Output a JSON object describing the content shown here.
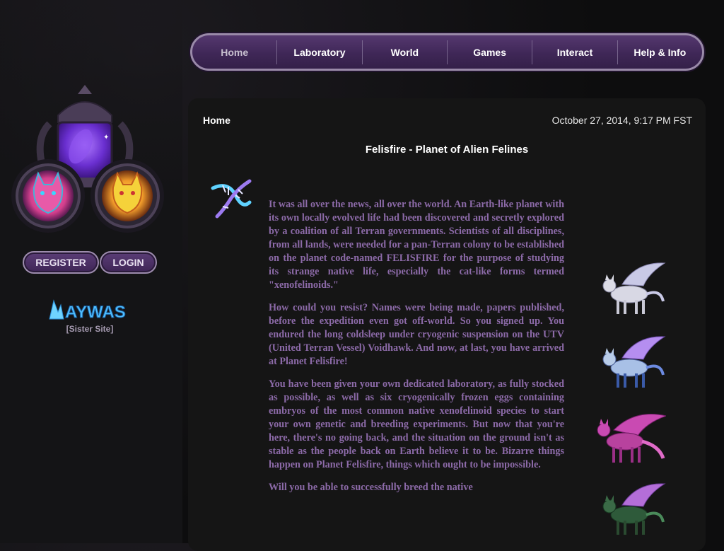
{
  "nav": {
    "items": [
      {
        "label": "Home",
        "active": true
      },
      {
        "label": "Laboratory"
      },
      {
        "label": "World"
      },
      {
        "label": "Games"
      },
      {
        "label": "Interact"
      },
      {
        "label": "Help & Info"
      }
    ]
  },
  "sidebar": {
    "register_label": "REGISTER",
    "login_label": "LOGIN",
    "sister_logo_text": "AYWAS",
    "sister_caption": "[Sister Site]"
  },
  "content": {
    "breadcrumb": "Home",
    "datetime": "October 27, 2014, 9:17 PM FST",
    "title": "Felisfire - Planet of Alien Felines",
    "paragraphs": [
      "It was all over the news, all over the world. An Earth-like planet with its own locally evolved life had been discovered and secretly explored by a coalition of all Terran governments. Scientists of all disciplines, from all lands, were needed for a pan-Terran colony to be established on the planet code-named FELISFIRE for the purpose of studying its strange native life, especially the cat-like forms termed \"xenofelinoids.\"",
      "How could you resist? Names were being made, papers published, before the expedition even got off-world. So you signed up. You endured the long coldsleep under cryogenic suspension on the UTV (United Terran Vessel) Voidhawk. And now, at last, you have arrived at Planet Felisfire!",
      "You have been given your own dedicated laboratory, as fully stocked as possible, as well as six cryogenically frozen eggs containing embryos of the most common native xenofelinoid species to start your own genetic and breeding experiments. But now that you're here, there's no going back, and the situation on the ground isn't as stable as the people back on Earth believe it to be. Bizarre things happen on Planet Felisfire, things which ought to be impossible.",
      "Will you be able to successfully breed the native"
    ]
  },
  "colors": {
    "accent_purple": "#3f2757",
    "text_purple": "#8c6aa8",
    "nav_border": "#9a8aa9"
  },
  "icons": {
    "dna": "dna-helix-icon",
    "creatures": [
      "winged-cat-silver",
      "winged-cat-blue",
      "winged-cat-magenta",
      "winged-cat-green"
    ]
  }
}
